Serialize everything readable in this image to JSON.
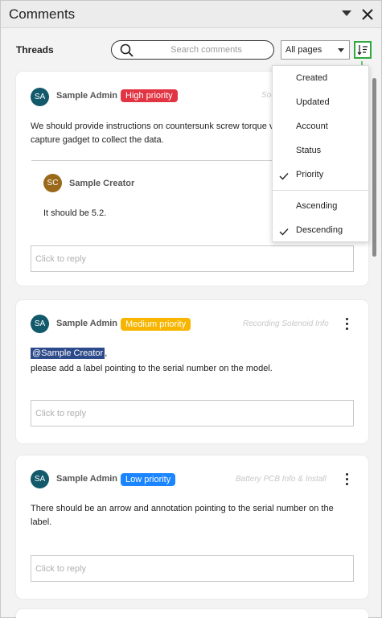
{
  "panel": {
    "title": "Comments",
    "collapse_icon": "triangle-down-icon",
    "close_icon": "close-icon"
  },
  "toolbar": {
    "label": "Threads",
    "search_placeholder": "Search comments",
    "page_filter": "All pages",
    "sort_icon": "sort-list-icon"
  },
  "sort_menu": {
    "field_options": [
      {
        "label": "Created",
        "checked": false
      },
      {
        "label": "Updated",
        "checked": false
      },
      {
        "label": "Account",
        "checked": false
      },
      {
        "label": "Status",
        "checked": false
      },
      {
        "label": "Priority",
        "checked": true
      }
    ],
    "order_options": [
      {
        "label": "Ascending",
        "checked": false
      },
      {
        "label": "Descending",
        "checked": true
      }
    ]
  },
  "threads": [
    {
      "avatar": "SA",
      "author": "Sample Admin",
      "priority": "High priority",
      "page_ref": "Sou",
      "text_line1": "We should provide instructions on countersunk screw torque v",
      "text_line2": "capture gadget to collect the data.",
      "reply": {
        "avatar": "SC",
        "author": "Sample Creator",
        "text": "It should be 5.2."
      },
      "reply_placeholder": "Click to reply"
    },
    {
      "avatar": "SA",
      "author": "Sample Admin",
      "priority": "Medium priority",
      "page_ref": "Recording Solenoid Info",
      "mention": "@Sample Creator",
      "mention_suffix": ",",
      "text_line1": "please add a label pointing to the serial number on the model.",
      "reply_placeholder": "Click to reply"
    },
    {
      "avatar": "SA",
      "author": "Sample Admin",
      "priority": "Low priority",
      "page_ref": "Battery PCB Info & Install",
      "text_line1": "There should be an arrow and annotation pointing to the serial number on the",
      "text_line2": "label.",
      "reply_placeholder": "Click to reply"
    }
  ],
  "colors": {
    "high": "#e23543",
    "medium": "#f7b500",
    "low": "#1a85ff",
    "avatar_admin": "#125a6b",
    "avatar_creator": "#9a6a1a",
    "sort_highlight": "#2eaa3c"
  }
}
